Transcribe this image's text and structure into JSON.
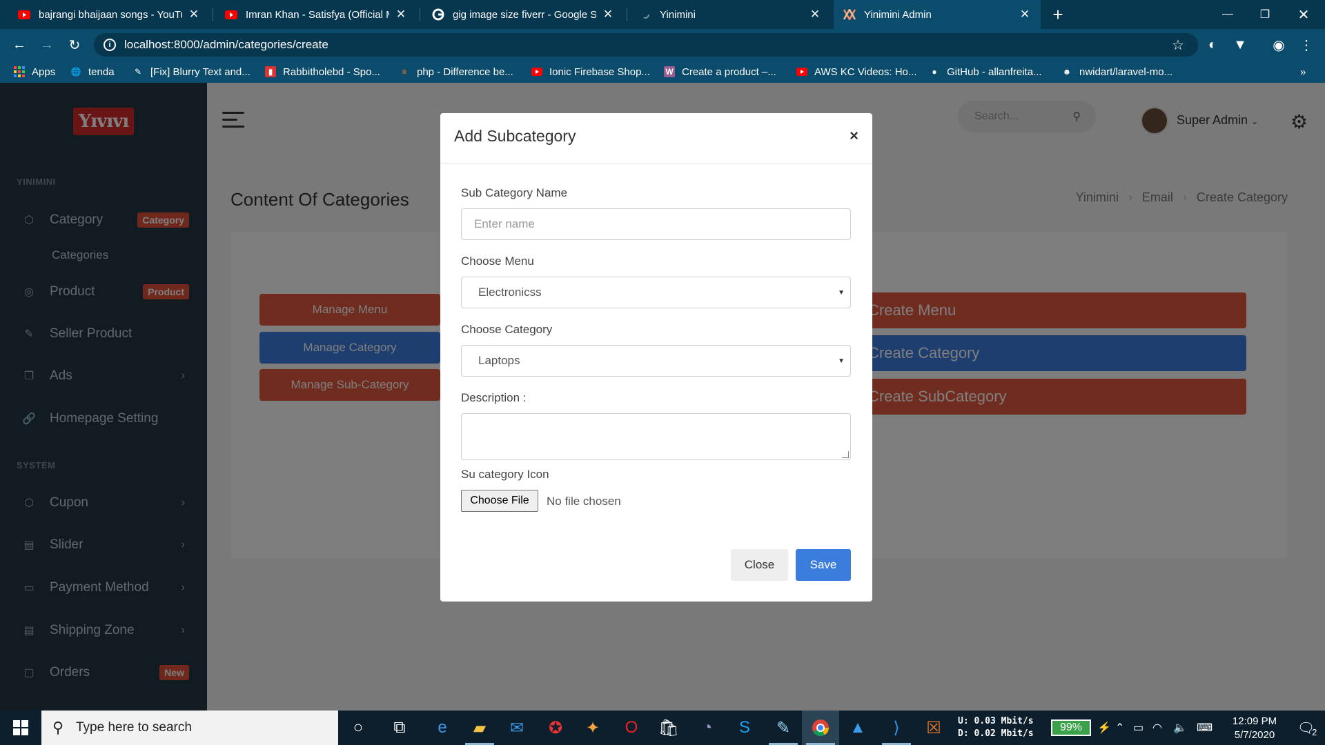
{
  "browser": {
    "tabs": [
      {
        "title": "bajrangi bhaijaan songs - YouTube",
        "icon": "youtube-icon"
      },
      {
        "title": "Imran Khan - Satisfya (Official Music Video)",
        "icon": "youtube-icon"
      },
      {
        "title": "gig image size fiverr - Google Search",
        "icon": "google-icon"
      },
      {
        "title": "Yinimini",
        "icon": "loading-icon"
      },
      {
        "title": "Yinimini Admin",
        "icon": "app-icon"
      }
    ],
    "url": "localhost:8000/admin/categories/create",
    "bookmarks": [
      {
        "label": "Apps"
      },
      {
        "label": "tenda"
      },
      {
        "label": "[Fix] Blurry Text and..."
      },
      {
        "label": "Rabbitholebd - Spo..."
      },
      {
        "label": "php - Difference be..."
      },
      {
        "label": "Ionic Firebase Shop..."
      },
      {
        "label": "Create a product –..."
      },
      {
        "label": "AWS KC Videos: Ho..."
      },
      {
        "label": "GitHub - allanfreita..."
      },
      {
        "label": "nwidart/laravel-mo..."
      }
    ]
  },
  "sidebar": {
    "logo": "Yıvıvı",
    "section1": "YINIMINI",
    "section2": "SYSTEM",
    "items": [
      {
        "label": "Category",
        "badge": "Category"
      },
      {
        "label": "Categories"
      },
      {
        "label": "Product",
        "badge": "Product"
      },
      {
        "label": "Seller Product"
      },
      {
        "label": "Ads"
      },
      {
        "label": "Homepage Setting"
      },
      {
        "label": "Cupon"
      },
      {
        "label": "Slider"
      },
      {
        "label": "Payment Method"
      },
      {
        "label": "Shipping Zone"
      },
      {
        "label": "Orders",
        "badge": "New"
      }
    ]
  },
  "header": {
    "search_placeholder": "Search...",
    "user": "Super Admin"
  },
  "content": {
    "title": "Content Of Categories",
    "breadcrumb": [
      "Yinimini",
      "Email",
      "Create Category"
    ],
    "left_buttons": [
      "Manage Menu",
      "Manage Category",
      "Manage Sub-Category"
    ],
    "right_buttons": [
      "Create Menu",
      "Create Category",
      "Create SubCategory"
    ]
  },
  "modal": {
    "title": "Add Subcategory",
    "close_x": "×",
    "name_label": "Sub Category Name",
    "name_placeholder": "Enter name",
    "menu_label": "Choose Menu",
    "menu_value": "Electronicss",
    "category_label": "Choose Category",
    "category_value": "Laptops",
    "description_label": "Description :",
    "icon_label": "Su category Icon",
    "choose_file": "Choose File",
    "no_file": "No file chosen",
    "close_btn": "Close",
    "save_btn": "Save"
  },
  "taskbar": {
    "search_placeholder": "Type here to search",
    "net_up": "U:  0.03 Mbit/s",
    "net_down": "D:  0.02 Mbit/s",
    "battery": "99%",
    "time": "12:09 PM",
    "date": "5/7/2020",
    "notifications": "2"
  },
  "colors": {
    "accent_orange": "#e0583f",
    "accent_blue": "#3b7ddd",
    "sidebar": "#263644",
    "chrome": "#0b4b6c"
  }
}
